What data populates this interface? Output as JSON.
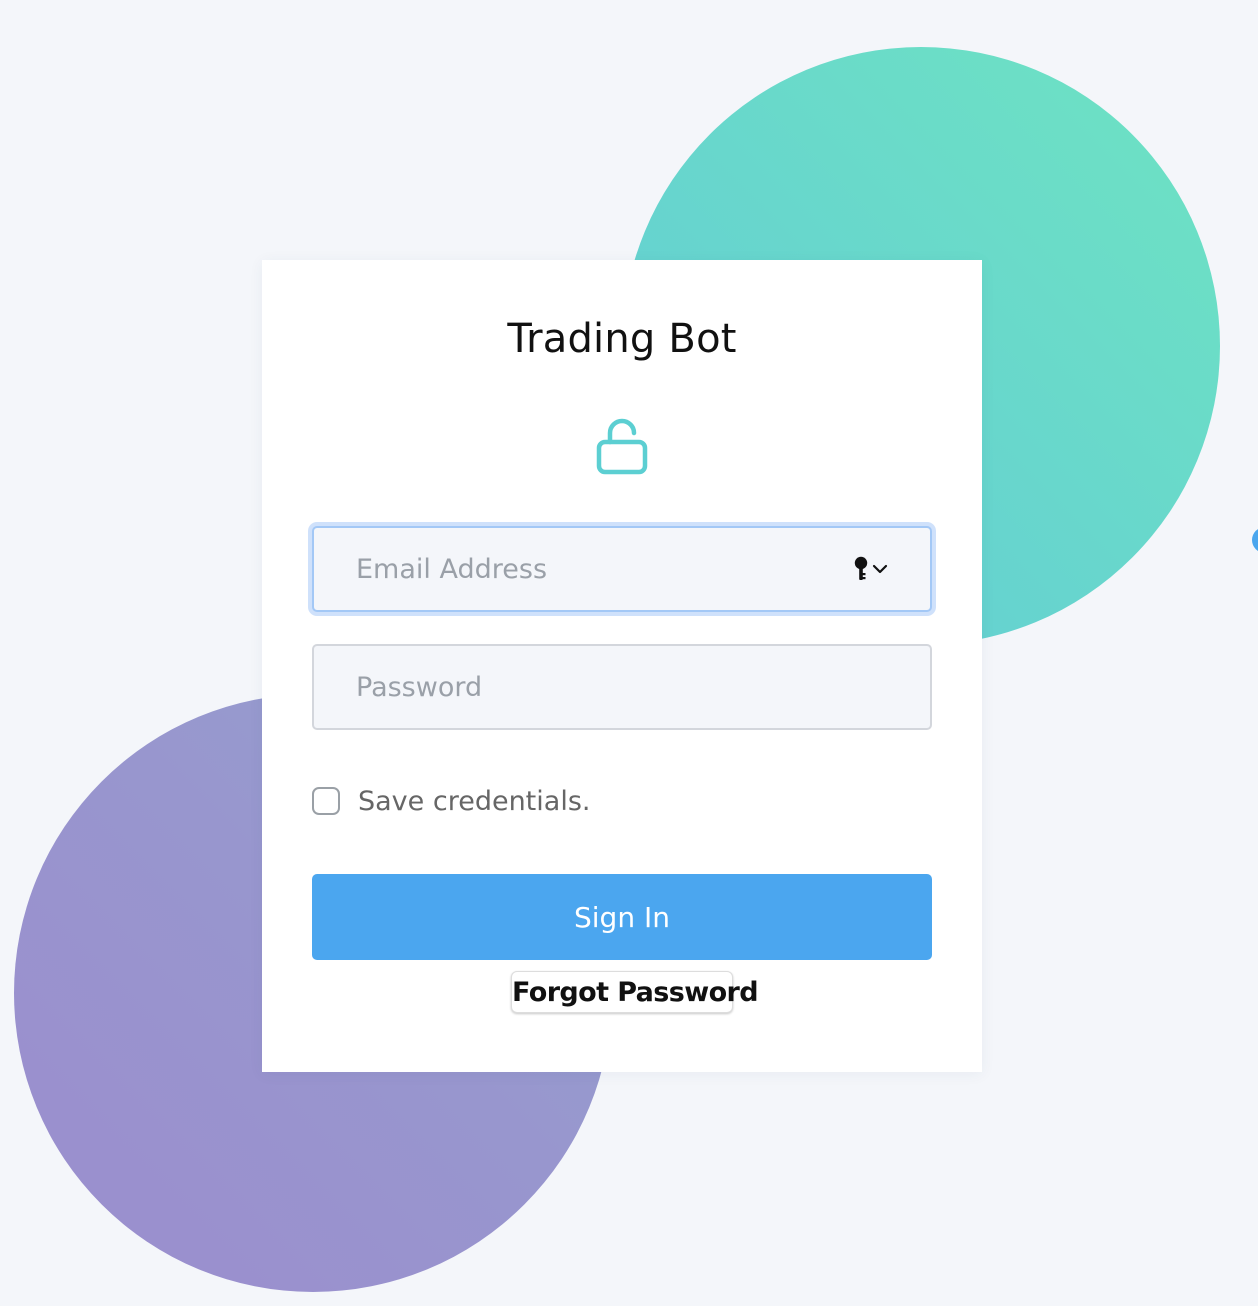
{
  "colors": {
    "background": "#f4f6fa",
    "card": "#ffffff",
    "accent_teal": "#62cbd6",
    "accent_green": "#6ee3c2",
    "accent_purple": "#9b8dce",
    "primary_button": "#4ba6ef",
    "focus_ring": "#a3c8f6",
    "lock_icon": "#5ccfd2"
  },
  "login": {
    "title": "Trading Bot",
    "icon": "unlocked-padlock-icon",
    "email": {
      "placeholder": "Email Address",
      "value": "",
      "autofill_icon": "key-icon",
      "dropdown_icon": "chevron-down-icon"
    },
    "password": {
      "placeholder": "Password",
      "value": ""
    },
    "remember": {
      "label": "Save credentials.",
      "checked": false
    },
    "signin_label": "Sign In",
    "forgot_label": "Forgot Password"
  }
}
